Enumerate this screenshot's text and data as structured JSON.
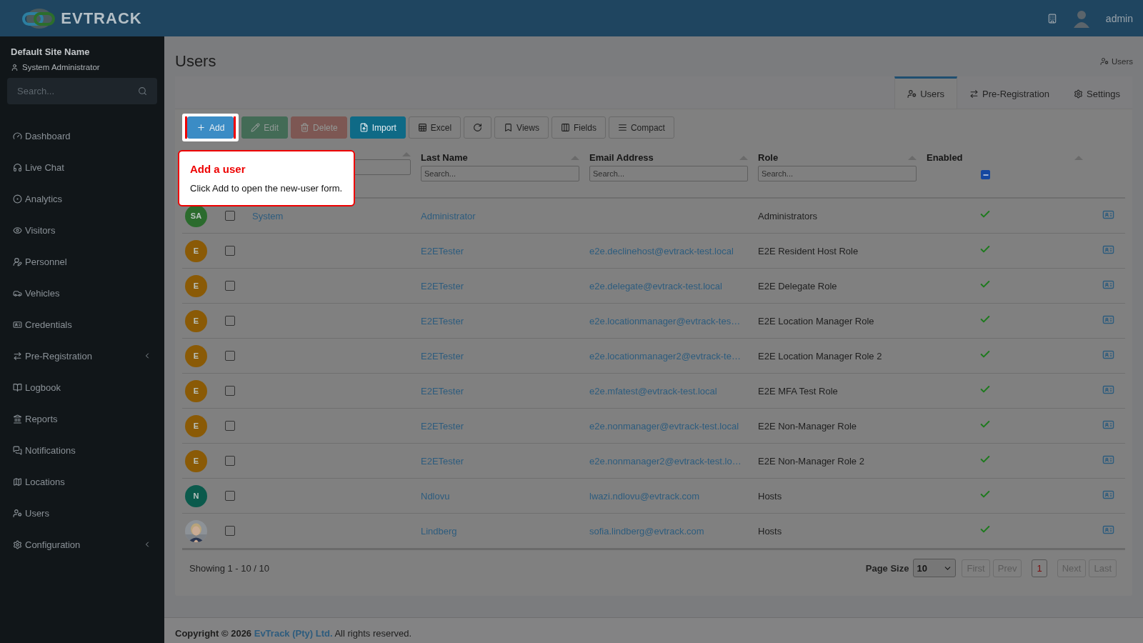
{
  "header": {
    "brand": "EVTRACK",
    "user": "admin"
  },
  "sidebar": {
    "site_name": "Default Site Name",
    "role": "System Administrator",
    "search": {
      "placeholder": "Search..."
    },
    "items": [
      {
        "label": "Dashboard",
        "has_submenu": false
      },
      {
        "label": "Live Chat",
        "has_submenu": false
      },
      {
        "label": "Analytics",
        "has_submenu": false
      },
      {
        "label": "Visitors",
        "has_submenu": false
      },
      {
        "label": "Personnel",
        "has_submenu": false
      },
      {
        "label": "Vehicles",
        "has_submenu": false
      },
      {
        "label": "Credentials",
        "has_submenu": false
      },
      {
        "label": "Pre-Registration",
        "has_submenu": true
      },
      {
        "label": "Logbook",
        "has_submenu": false
      },
      {
        "label": "Reports",
        "has_submenu": false
      },
      {
        "label": "Notifications",
        "has_submenu": false
      },
      {
        "label": "Locations",
        "has_submenu": false
      },
      {
        "label": "Users",
        "has_submenu": false
      },
      {
        "label": "Configuration",
        "has_submenu": true
      }
    ]
  },
  "page": {
    "title": "Users",
    "breadcrumb": "Users"
  },
  "tabs": [
    {
      "label": "Users",
      "selected": true
    },
    {
      "label": "Pre-Registration",
      "selected": false
    },
    {
      "label": "Settings",
      "selected": false
    }
  ],
  "toolbar": [
    {
      "kind": "add",
      "label": "Add",
      "disabled": false,
      "highlighted": true
    },
    {
      "kind": "edit",
      "label": "Edit",
      "disabled": true,
      "highlighted": false
    },
    {
      "kind": "delete",
      "label": "Delete",
      "disabled": true,
      "highlighted": false
    },
    {
      "kind": "import",
      "label": "Import",
      "disabled": false,
      "highlighted": false
    },
    {
      "kind": "excel",
      "label": "Excel",
      "disabled": false,
      "highlighted": false
    },
    {
      "kind": "refresh",
      "disabled": false,
      "highlighted": false
    },
    {
      "kind": "views",
      "label": "Views",
      "disabled": false,
      "highlighted": false
    },
    {
      "kind": "fields",
      "label": "Fields",
      "disabled": false,
      "highlighted": false
    },
    {
      "kind": "compact",
      "label": "Compact",
      "disabled": false,
      "highlighted": false
    }
  ],
  "tooltip": {
    "title": "Add a user",
    "text": "Click Add to open the new-user form."
  },
  "table": {
    "columns": [
      {
        "label": "Last Name",
        "placeholder": "Search..."
      },
      {
        "label": "Email Address",
        "placeholder": "Search..."
      },
      {
        "label": "Role",
        "placeholder": "Search..."
      },
      {
        "label": "Enabled"
      }
    ],
    "enabled_filter": {
      "indeterminate": true
    },
    "rows": [
      {
        "avatar": {
          "kind": "initials",
          "initials": "SA",
          "color": "#2b6b2d"
        },
        "checked": false,
        "first_name": "System",
        "last_name": "Administrator",
        "role": "Administrators",
        "enabled": true
      },
      {
        "avatar": {
          "kind": "initials",
          "initials": "E",
          "color": "#8a5a06"
        },
        "checked": false,
        "last_name": "E2ETester",
        "email": "e2e.declinehost@evtrack-test.local",
        "role": "E2E Resident Host Role",
        "enabled": true
      },
      {
        "avatar": {
          "kind": "initials",
          "initials": "E",
          "color": "#8a5a06"
        },
        "checked": false,
        "last_name": "E2ETester",
        "email": "e2e.delegate@evtrack-test.local",
        "role": "E2E Delegate Role",
        "enabled": true
      },
      {
        "avatar": {
          "kind": "initials",
          "initials": "E",
          "color": "#8a5a06"
        },
        "checked": false,
        "last_name": "E2ETester",
        "email": "e2e.locationmanager@evtrack-tes…",
        "role": "E2E Location Manager Role",
        "enabled": true
      },
      {
        "avatar": {
          "kind": "initials",
          "initials": "E",
          "color": "#8a5a06"
        },
        "checked": false,
        "last_name": "E2ETester",
        "email": "e2e.locationmanager2@evtrack-te…",
        "role": "E2E Location Manager Role 2",
        "enabled": true
      },
      {
        "avatar": {
          "kind": "initials",
          "initials": "E",
          "color": "#8a5a06"
        },
        "checked": false,
        "last_name": "E2ETester",
        "email": "e2e.mfatest@evtrack-test.local",
        "role": "E2E MFA Test Role",
        "enabled": true
      },
      {
        "avatar": {
          "kind": "initials",
          "initials": "E",
          "color": "#8a5a06"
        },
        "checked": false,
        "last_name": "E2ETester",
        "email": "e2e.nonmanager@evtrack-test.local",
        "role": "E2E Non-Manager Role",
        "enabled": true
      },
      {
        "avatar": {
          "kind": "initials",
          "initials": "E",
          "color": "#8a5a06"
        },
        "checked": false,
        "last_name": "E2ETester",
        "email": "e2e.nonmanager2@evtrack-test.lo…",
        "role": "E2E Non-Manager Role 2",
        "enabled": true
      },
      {
        "avatar": {
          "kind": "initials",
          "initials": "N",
          "color": "#0b5a4c"
        },
        "checked": false,
        "last_name": "Ndlovu",
        "email": "lwazi.ndlovu@evtrack.com",
        "role": "Hosts",
        "enabled": true
      },
      {
        "checked": false,
        "last_name": "Lindberg",
        "email": "sofia.lindberg@evtrack.com",
        "role": "Hosts",
        "enabled": true
      }
    ]
  },
  "footer": {
    "showing": "Showing 1 - 10 / 10",
    "page_size_label": "Page Size",
    "page_size": "10",
    "pages": [
      {
        "label": "First",
        "disabled": true,
        "selected": false
      },
      {
        "label": "Prev",
        "disabled": true,
        "selected": false
      },
      {
        "label": "1",
        "disabled": false,
        "selected": true
      },
      {
        "label": "Next",
        "disabled": true,
        "selected": false
      },
      {
        "label": "Last",
        "disabled": true,
        "selected": false
      }
    ]
  },
  "copyright": "Copyright © 2026 ",
  "company": "EvTrack (Pty) Ltd.",
  "rights": " All rights reserved."
}
